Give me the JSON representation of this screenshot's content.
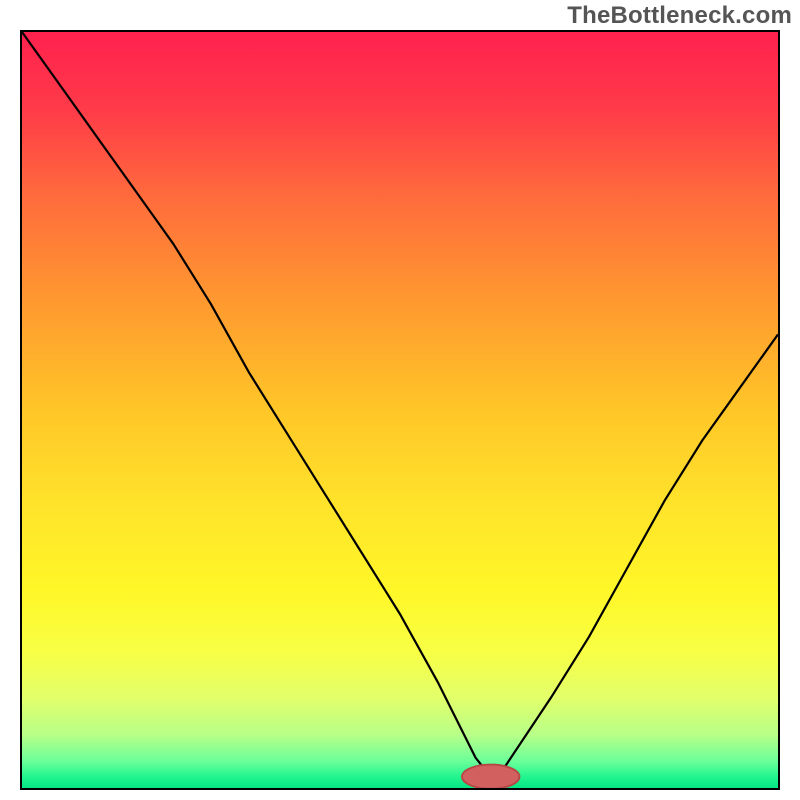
{
  "watermark": "TheBottleneck.com",
  "colors": {
    "frame": "#000000",
    "curve": "#000000",
    "marker_fill": "#d1605e",
    "marker_stroke": "#b64846",
    "gradient_stops": [
      {
        "offset": 0.0,
        "color": "#ff214e"
      },
      {
        "offset": 0.1,
        "color": "#ff3a49"
      },
      {
        "offset": 0.22,
        "color": "#ff6c3c"
      },
      {
        "offset": 0.36,
        "color": "#ff9a2f"
      },
      {
        "offset": 0.5,
        "color": "#ffc628"
      },
      {
        "offset": 0.62,
        "color": "#ffe22a"
      },
      {
        "offset": 0.74,
        "color": "#fff728"
      },
      {
        "offset": 0.82,
        "color": "#f7ff45"
      },
      {
        "offset": 0.88,
        "color": "#e3ff6a"
      },
      {
        "offset": 0.93,
        "color": "#b7ff88"
      },
      {
        "offset": 0.965,
        "color": "#6aff9a"
      },
      {
        "offset": 0.985,
        "color": "#22f58f"
      },
      {
        "offset": 1.0,
        "color": "#04e784"
      }
    ]
  },
  "chart_data": {
    "type": "line",
    "title": "",
    "xlabel": "",
    "ylabel": "",
    "xlim": [
      0,
      100
    ],
    "ylim": [
      0,
      100
    ],
    "marker": {
      "x": 62,
      "y": 1.5,
      "rx": 3.8,
      "ry": 1.6
    },
    "series": [
      {
        "name": "bottleneck-curve",
        "x": [
          0,
          5,
          10,
          15,
          20,
          25,
          30,
          35,
          40,
          45,
          50,
          55,
          58,
          60,
          62,
          64,
          66,
          70,
          75,
          80,
          85,
          90,
          95,
          100
        ],
        "values": [
          100,
          93,
          86,
          79,
          72,
          64,
          55,
          47,
          39,
          31,
          23,
          14,
          8,
          4,
          1.5,
          3,
          6,
          12,
          20,
          29,
          38,
          46,
          53,
          60
        ]
      }
    ]
  }
}
